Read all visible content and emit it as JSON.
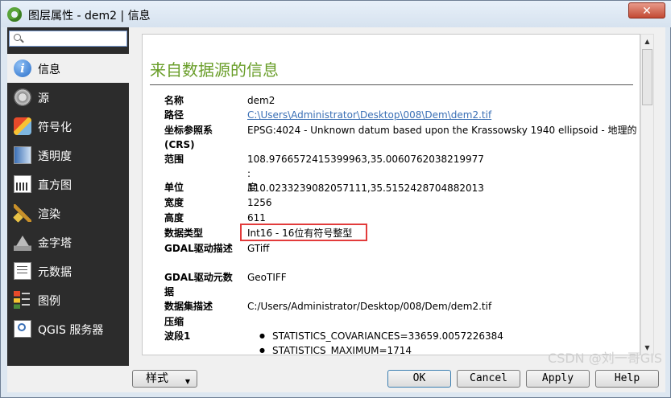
{
  "window": {
    "title": "图层属性 - dem2 | 信息"
  },
  "search": {
    "placeholder": ""
  },
  "sidebar": {
    "items": [
      {
        "label": "信息",
        "icon": "info-icon"
      },
      {
        "label": "源",
        "icon": "source-icon"
      },
      {
        "label": "符号化",
        "icon": "symbology-icon"
      },
      {
        "label": "透明度",
        "icon": "transparency-icon"
      },
      {
        "label": "直方图",
        "icon": "histogram-icon"
      },
      {
        "label": "渲染",
        "icon": "rendering-icon"
      },
      {
        "label": "金字塔",
        "icon": "pyramids-icon"
      },
      {
        "label": "元数据",
        "icon": "metadata-icon"
      },
      {
        "label": "图例",
        "icon": "legend-icon"
      },
      {
        "label": "QGIS 服务器",
        "icon": "qgis-server-icon"
      }
    ]
  },
  "main": {
    "heading": "来自数据源的信息",
    "rows": [
      {
        "key": "名称",
        "value": "dem2"
      },
      {
        "key": "路径",
        "value": "C:\\Users\\Administrator\\Desktop\\008\\Dem\\dem2.tif"
      },
      {
        "key": "坐标参照系 (CRS)",
        "value": "EPSG:4024 - Unknown datum based upon the Krassowsky 1940 ellipsoid - 地理的"
      },
      {
        "key": "范围",
        "value": "108.9766572415399963,35.0060762038219977 : 110.0233239082057111,35.5152428704882013"
      },
      {
        "key": "单位",
        "value": "度"
      },
      {
        "key": "宽度",
        "value": "1256"
      },
      {
        "key": "高度",
        "value": "611"
      },
      {
        "key": "数据类型",
        "value": "Int16 - 16位有符号整型"
      },
      {
        "key": "GDAL驱动描述",
        "value": "GTiff"
      },
      {
        "key": "GDAL驱动元数据",
        "value": "GeoTIFF"
      },
      {
        "key": "数据集描述",
        "value": "C:/Users/Administrator/Desktop/008/Dem/dem2.tif"
      },
      {
        "key": "压缩",
        "value": ""
      },
      {
        "key": "波段1",
        "value": ""
      }
    ],
    "band1": [
      "STATISTICS_COVARIANCES=33659.0057226384",
      "STATISTICS_MAXIMUM=1714"
    ]
  },
  "footer": {
    "style_label": "样式",
    "ok_label": "OK",
    "cancel_label": "Cancel",
    "apply_label": "Apply",
    "help_label": "Help",
    "watermark": "CSDN @刘一哥GIS"
  },
  "colors": {
    "heading": "#6a9e2a",
    "highlight": "#e23b3b",
    "sidebar_bg": "#2c2c2c"
  }
}
